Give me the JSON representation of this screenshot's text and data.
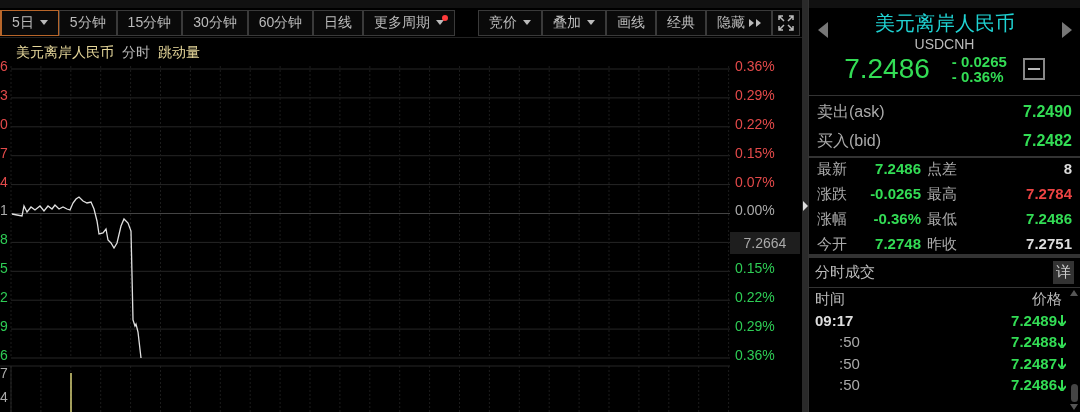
{
  "toolbar_left": [
    {
      "label": "5日",
      "dropdown": true,
      "alert": false,
      "selected": true
    },
    {
      "label": "5分钟",
      "dropdown": false,
      "alert": false,
      "selected": false
    },
    {
      "label": "15分钟",
      "dropdown": false,
      "alert": false,
      "selected": false
    },
    {
      "label": "30分钟",
      "dropdown": false,
      "alert": false,
      "selected": false
    },
    {
      "label": "60分钟",
      "dropdown": false,
      "alert": false,
      "selected": false
    },
    {
      "label": "日线",
      "dropdown": false,
      "alert": false,
      "selected": false
    },
    {
      "label": "更多周期",
      "dropdown": true,
      "alert": true,
      "selected": false
    }
  ],
  "toolbar_right": [
    {
      "label": "竞价",
      "dropdown": true,
      "kind": "text"
    },
    {
      "label": "叠加",
      "dropdown": true,
      "kind": "text"
    },
    {
      "label": "画线",
      "dropdown": false,
      "kind": "text"
    },
    {
      "label": "经典",
      "dropdown": false,
      "kind": "text"
    },
    {
      "label": "隐藏",
      "dropdown": false,
      "kind": "collapse"
    },
    {
      "kind": "fullscreen"
    }
  ],
  "chart": {
    "instrument": "美元离岸人民币",
    "mode": "分时",
    "indicator": "跳动量",
    "left_axis": [
      {
        "label": "6",
        "kind": "up"
      },
      {
        "label": "3",
        "kind": "up"
      },
      {
        "label": "0",
        "kind": "up"
      },
      {
        "label": "7",
        "kind": "up"
      },
      {
        "label": "4",
        "kind": "up"
      },
      {
        "label": "1",
        "kind": "flat"
      },
      {
        "label": "8",
        "kind": "down"
      },
      {
        "label": "5",
        "kind": "down"
      },
      {
        "label": "2",
        "kind": "down"
      },
      {
        "label": "9",
        "kind": "down"
      },
      {
        "label": "6",
        "kind": "down"
      }
    ],
    "right_axis": [
      {
        "label": "0.36%",
        "kind": "up"
      },
      {
        "label": "0.29%",
        "kind": "up"
      },
      {
        "label": "0.22%",
        "kind": "up"
      },
      {
        "label": "0.15%",
        "kind": "up"
      },
      {
        "label": "0.07%",
        "kind": "up"
      },
      {
        "label": "0.00%",
        "kind": "flat"
      },
      {
        "label": "7.2664",
        "kind": "crosshair"
      },
      {
        "label": "0.15%",
        "kind": "down"
      },
      {
        "label": "0.22%",
        "kind": "down"
      },
      {
        "label": "0.29%",
        "kind": "down"
      },
      {
        "label": "0.36%",
        "kind": "down"
      }
    ],
    "volume_axis": [
      "7",
      "4"
    ]
  },
  "quote": {
    "name": "美元离岸人民币",
    "code": "USDCNH",
    "price": "7.2486",
    "change": "- 0.0265",
    "change_pct": "- 0.36%"
  },
  "ask_bid": [
    {
      "label": "卖出(ask)",
      "value": "7.2490"
    },
    {
      "label": "买入(bid)",
      "value": "7.2482"
    }
  ],
  "stats": [
    {
      "label": "最新",
      "value": "7.2486",
      "kind": "down"
    },
    {
      "label": "点差",
      "value": "8",
      "kind": "flat"
    },
    {
      "label": "涨跌",
      "value": "-0.0265",
      "kind": "down"
    },
    {
      "label": "最高",
      "value": "7.2784",
      "kind": "up"
    },
    {
      "label": "涨幅",
      "value": "-0.36%",
      "kind": "down"
    },
    {
      "label": "最低",
      "value": "7.2486",
      "kind": "down"
    },
    {
      "label": "今开",
      "value": "7.2748",
      "kind": "down"
    },
    {
      "label": "昨收",
      "value": "7.2751",
      "kind": "flat"
    }
  ],
  "ticks": {
    "title": "分时成交",
    "detail_button": "详",
    "columns": [
      "时间",
      "价格"
    ],
    "rows": [
      {
        "time": "09:17",
        "bold": true,
        "price": "7.2489",
        "kind": "down"
      },
      {
        "time": ":50",
        "bold": false,
        "price": "7.2488",
        "kind": "down"
      },
      {
        "time": ":50",
        "bold": false,
        "price": "7.2487",
        "kind": "down"
      },
      {
        "time": ":50",
        "bold": false,
        "price": "7.2486",
        "kind": "down"
      }
    ]
  }
}
